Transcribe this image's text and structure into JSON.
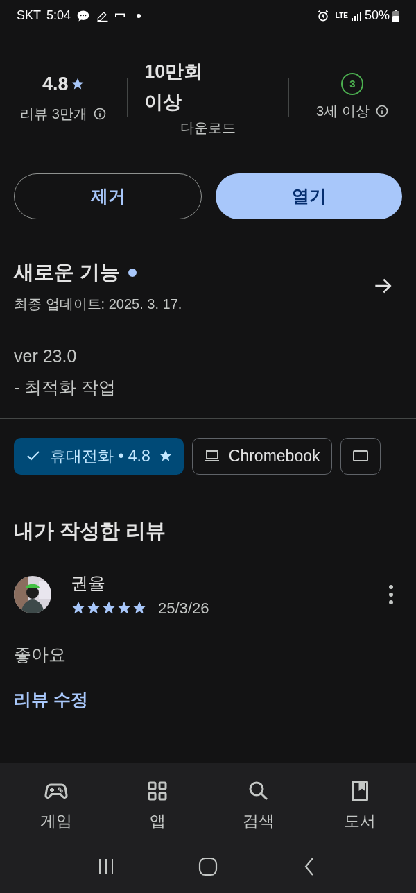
{
  "status_bar": {
    "carrier": "SKT",
    "time": "5:04",
    "network": "LTE",
    "battery": "50%"
  },
  "stats": {
    "rating": "4.8",
    "reviews": "리뷰 3만개",
    "downloads_line1": "10만회",
    "downloads_line2": "이상",
    "downloads_label": "다운로드",
    "age_badge": "3",
    "age_label": "3세 이상"
  },
  "buttons": [
    {
      "label": "제거",
      "kind": "outline"
    },
    {
      "label": "열기",
      "kind": "filled"
    }
  ],
  "whats_new": {
    "title": "새로운 기능",
    "unread": true,
    "updated": "최종 업데이트: 2025. 3. 17.",
    "version": "ver 23.0",
    "notes": "- 최적화 작업"
  },
  "device_chips": [
    {
      "label": "휴대전화 • 4.8",
      "kind": "phone",
      "selected": true
    },
    {
      "label": "Chromebook",
      "kind": "laptop",
      "selected": false
    },
    {
      "kind": "tablet",
      "selected": false
    }
  ],
  "my_review": {
    "heading": "내가 작성한 리뷰",
    "author": "권율",
    "stars": 5,
    "date": "25/3/26",
    "text": "좋아요",
    "edit_link": "리뷰 수정"
  },
  "bottom_nav": [
    {
      "label": "게임",
      "kind": "games",
      "selected": false
    },
    {
      "label": "앱",
      "kind": "apps",
      "selected": false
    },
    {
      "label": "검색",
      "kind": "search",
      "selected": false
    },
    {
      "label": "도서",
      "kind": "books",
      "selected": false
    }
  ]
}
